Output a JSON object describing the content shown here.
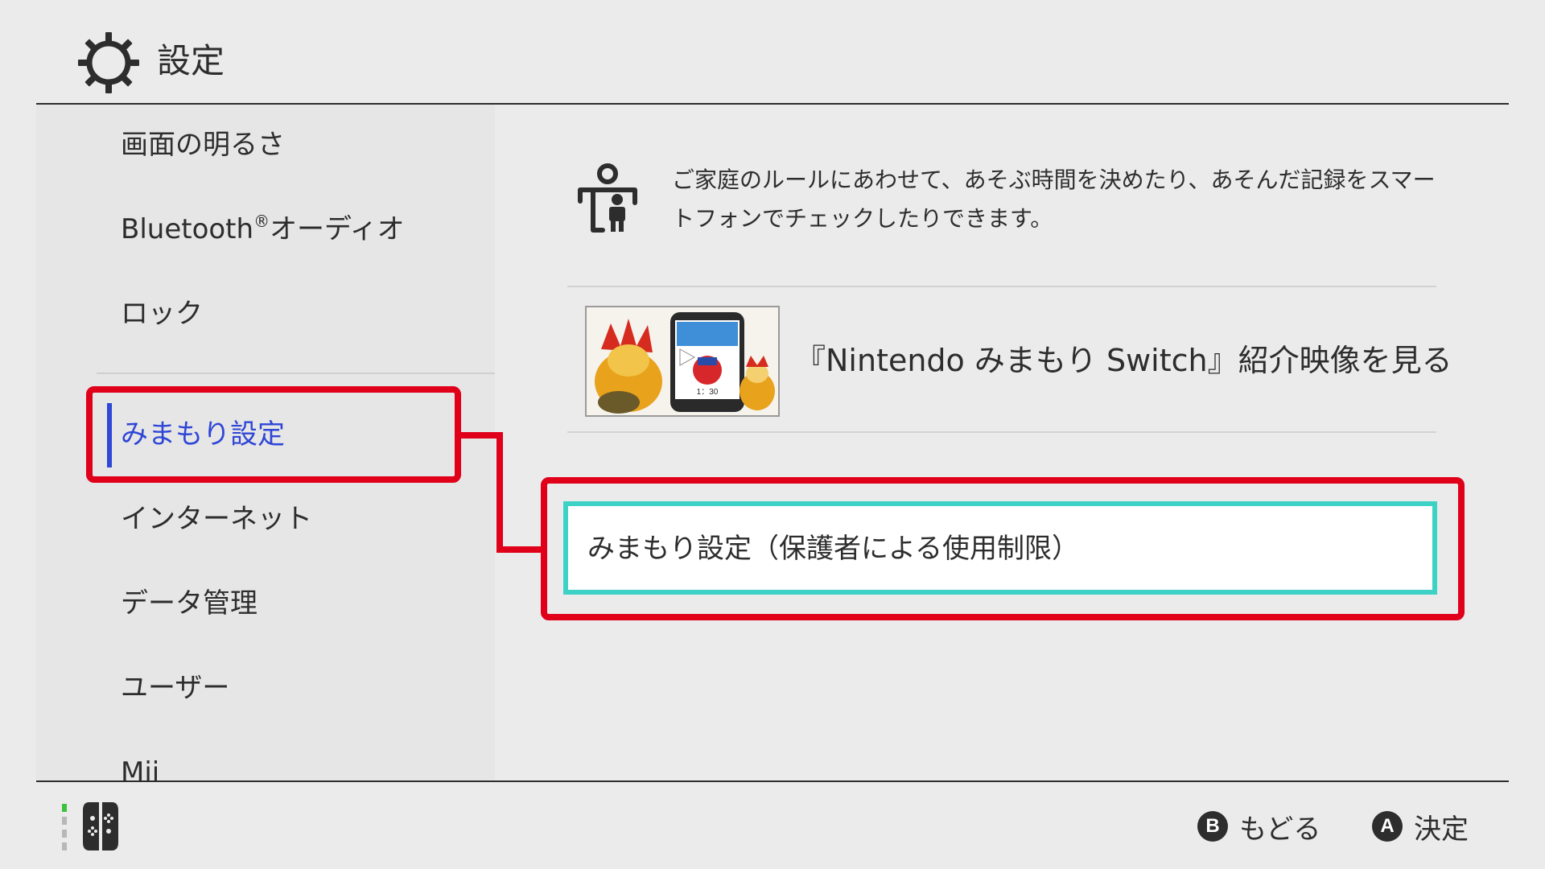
{
  "header": {
    "title": "設定",
    "icon": "gear-icon"
  },
  "sidebar": {
    "items": [
      {
        "label": "画面の明るさ"
      },
      {
        "label": "Bluetooth",
        "suffix": "オーディオ",
        "mark": "®"
      },
      {
        "label": "ロック"
      },
      {
        "label": "みまもり設定",
        "selected": true
      },
      {
        "label": "インターネット"
      },
      {
        "label": "データ管理"
      },
      {
        "label": "ユーザー"
      },
      {
        "label": "Mii"
      }
    ],
    "active_color": "#2f46d6"
  },
  "main": {
    "description": "ご家庭のルールにあわせて、あそぶ時間を決めたり、あそんだ記録をスマートフォンでチェックしたりできます。",
    "video_link_label": "『Nintendo みまもり Switch』紹介映像を見る",
    "video_thumbnail_time": "1：30",
    "option_button_label": "みまもり設定（保護者による使用制限）",
    "focus_color": "#3ed2c6"
  },
  "annotation": {
    "highlight_color": "#e0001a"
  },
  "footer": {
    "back_glyph": "B",
    "back_label": "もどる",
    "ok_glyph": "A",
    "ok_label": "決定"
  }
}
